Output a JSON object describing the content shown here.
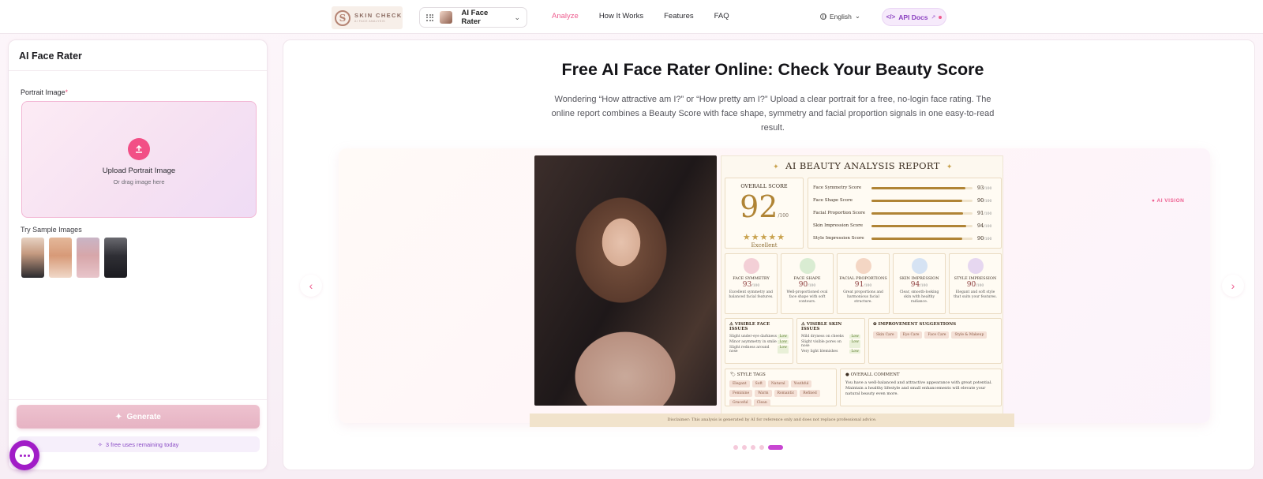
{
  "nav": {
    "logo_text": "SKIN CHECK",
    "logo_tagline": "AI FACE ANALYSIS",
    "tool_selector": "AI Face Rater",
    "links": [
      "Analyze",
      "How It Works",
      "Features",
      "FAQ"
    ],
    "active_link": "Analyze",
    "language": "English",
    "api_docs": "API Docs"
  },
  "left_panel": {
    "title": "AI Face Rater",
    "portrait_label": "Portrait Image",
    "required_mark": "*",
    "upload_title": "Upload Portrait Image",
    "upload_sub": "Or drag image here",
    "samples_label": "Try Sample Images",
    "generate_label": "Generate",
    "free_uses": "3 free uses remaining today"
  },
  "hero": {
    "title": "Free AI Face Rater Online: Check Your Beauty Score",
    "description": "Wondering “How attractive am I?” or “How pretty am I?” Upload a clear portrait for a free, no-login face rating. The online report combines a Beauty Score with face shape, symmetry and facial proportion signals in one easy-to-read result."
  },
  "carousel": {
    "badge": "AI VISION",
    "prev_icon": "chevron-left-icon",
    "next_icon": "chevron-right-icon",
    "dot_count": 5,
    "active_dot": 5
  },
  "report": {
    "title": "AI BEAUTY ANALYSIS REPORT",
    "overall_label": "OVERALL SCORE",
    "overall_score": "92",
    "overall_max": "/100",
    "overall_rating": "Excellent",
    "scores": [
      {
        "name": "Face Symmetry Score",
        "value": "93",
        "pct": 0.93
      },
      {
        "name": "Face Shape Score",
        "value": "90",
        "pct": 0.9
      },
      {
        "name": "Facial Proportion Score",
        "value": "91",
        "pct": 0.91
      },
      {
        "name": "Skin Impression Score",
        "value": "94",
        "pct": 0.94
      },
      {
        "name": "Style Impression Score",
        "value": "90",
        "pct": 0.9
      }
    ],
    "score_max": "/100",
    "cards": [
      {
        "title": "FACE SYMMETRY",
        "value": "93",
        "desc": "Excellent symmetry and balanced facial features.",
        "color": "#f3cfd6"
      },
      {
        "title": "FACE SHAPE",
        "value": "90",
        "desc": "Well-proportioned oval face shape with soft contours.",
        "color": "#d9ecd2"
      },
      {
        "title": "FACIAL PROPORTIONS",
        "value": "91",
        "desc": "Great proportions and harmonious facial structure.",
        "color": "#f4d6c4"
      },
      {
        "title": "SKIN IMPRESSION",
        "value": "94",
        "desc": "Clear, smooth-looking skin with healthy radiance.",
        "color": "#d6e3f3"
      },
      {
        "title": "STYLE IMPRESSION",
        "value": "90",
        "desc": "Elegant and soft style that suits your features.",
        "color": "#e6d7f0"
      }
    ],
    "face_issues_title": "VISIBLE FACE ISSUES",
    "face_issues": [
      "Slight under-eye darkness",
      "Minor asymmetry in smile",
      "Slight redness around nose"
    ],
    "skin_issues_title": "VISIBLE SKIN ISSUES",
    "skin_issues": [
      "Mild dryness on cheeks",
      "Slight visible pores on nose",
      "Very light blemishes"
    ],
    "issue_level": "Low",
    "improve_title": "IMPROVEMENT SUGGESTIONS",
    "improve_items": [
      "Skin Care",
      "Eye Care",
      "Face Care",
      "Style & Makeup"
    ],
    "tags_title": "STYLE TAGS",
    "tags": [
      "Elegant",
      "Soft",
      "Natural",
      "Youthful",
      "Feminine",
      "Warm",
      "Romantic",
      "Refined",
      "Graceful",
      "Clean"
    ],
    "comment_title": "OVERALL COMMENT",
    "comment": "You have a well-balanced and attractive appearance with great potential. Maintain a healthy lifestyle and small enhancements will elevate your natural beauty even more.",
    "disclaimer": "Disclaimer: This analysis is generated by AI for reference only and does not replace professional advice."
  }
}
